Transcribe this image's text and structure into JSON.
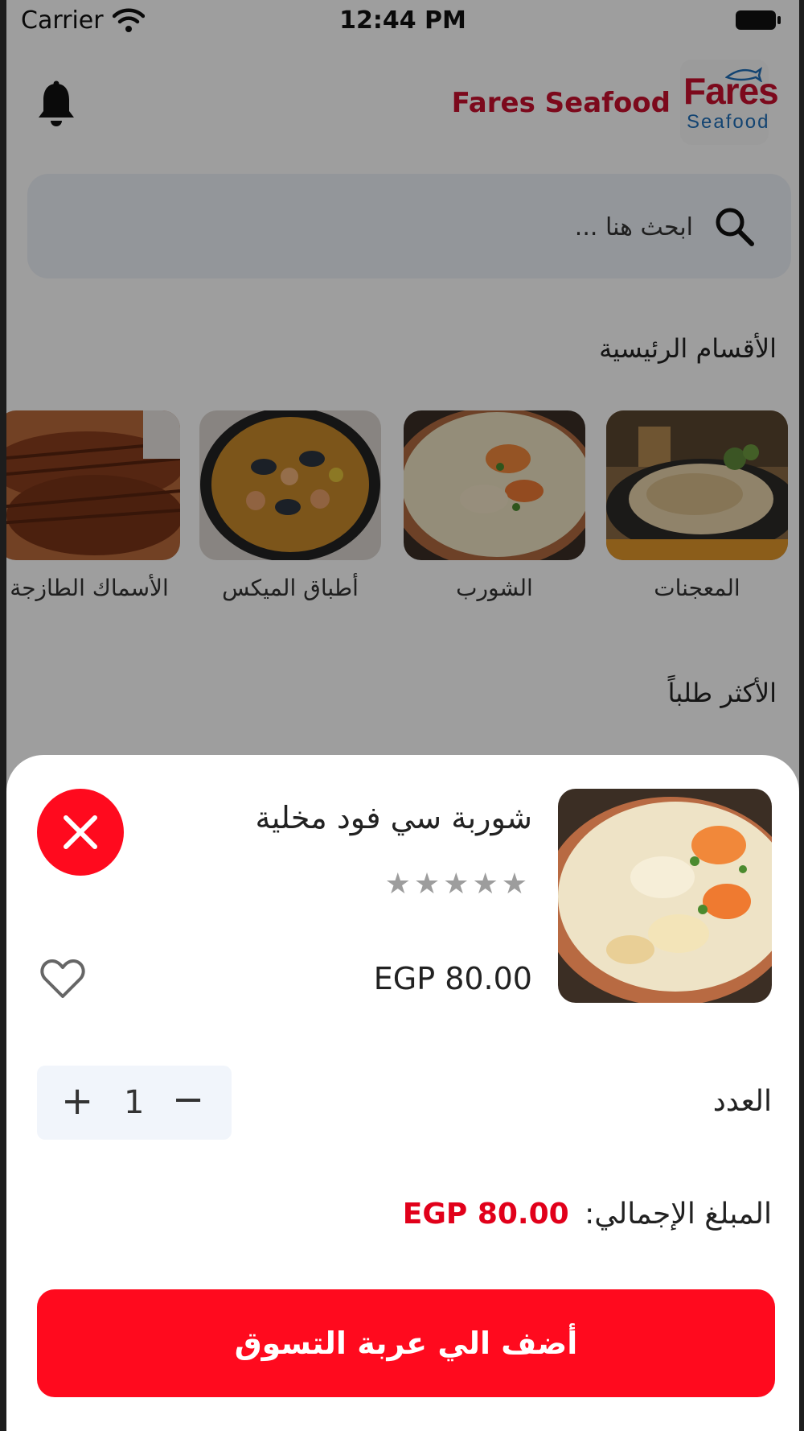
{
  "status_bar": {
    "carrier": "Carrier",
    "time": "12:44 PM"
  },
  "header": {
    "brand_title": "Fares Seafood",
    "logo_line1": "Fares",
    "logo_line2": "Seafood"
  },
  "search": {
    "placeholder": "ابحث هنا ..."
  },
  "sections": {
    "main_categories": "الأقسام الرئيسية",
    "most_ordered": "الأكثر طلباً"
  },
  "categories": [
    {
      "label": "المعجنات"
    },
    {
      "label": "الشورب"
    },
    {
      "label": "أطباق الميكس"
    },
    {
      "label": "الأسماك الطازجة"
    }
  ],
  "product_sheet": {
    "name": "شوربة سي فود مخلية",
    "rating": 0,
    "rating_max": 5,
    "stars": "★★★★★",
    "price": "EGP 80.00",
    "quantity_label": "العدد",
    "quantity": "1",
    "total_label": "المبلغ الإجمالي:",
    "total_value": "EGP 80.00",
    "add_to_cart": "أضف الي عربة التسوق"
  },
  "colors": {
    "accent": "#ff0a1e",
    "brand": "#c8102e",
    "logo_blue": "#1f6fb8",
    "search_bg": "#eef2f8"
  }
}
